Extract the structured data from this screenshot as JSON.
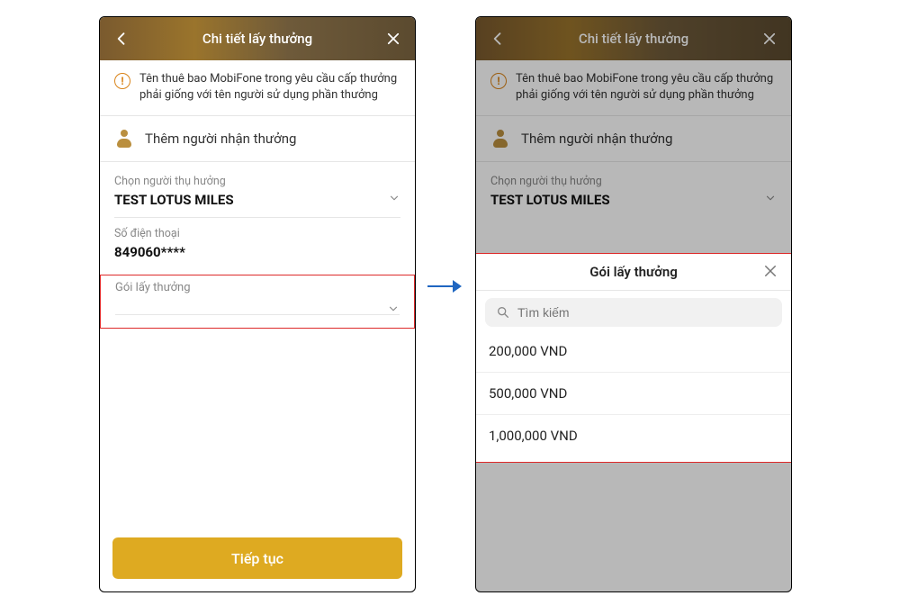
{
  "header": {
    "title": "Chi tiết lấy thưởng"
  },
  "warning": {
    "text": "Tên thuê bao MobiFone trong yêu cầu cấp thưởng phải giống với tên người sử dụng phần thưởng"
  },
  "add_recipient": {
    "label": "Thêm người nhận thưởng"
  },
  "beneficiary": {
    "label": "Chọn người thụ hưởng",
    "value": "TEST LOTUS MILES"
  },
  "phone": {
    "label": "Số điện thoại",
    "value": "849060****"
  },
  "package_field": {
    "label": "Gói lấy thưởng"
  },
  "cta": {
    "label": "Tiếp tục"
  },
  "sheet": {
    "title": "Gói lấy thưởng",
    "search_placeholder": "Tìm kiếm",
    "options": [
      "200,000 VND",
      "500,000 VND",
      "1,000,000 VND"
    ]
  }
}
